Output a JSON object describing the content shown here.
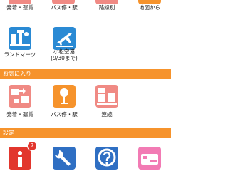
{
  "search": {
    "items": [
      {
        "label": "発着・運賃"
      },
      {
        "label": "バス停・駅"
      },
      {
        "label": "路線別"
      },
      {
        "label": "地図から"
      },
      {
        "label": "ランドマーク"
      },
      {
        "label": "小松空港",
        "sublabel": "(9/30まで)"
      }
    ]
  },
  "favorites": {
    "title": "お気に入り",
    "items": [
      {
        "label": "発着・運賃"
      },
      {
        "label": "バス停・駅"
      },
      {
        "label": "連続"
      }
    ]
  },
  "settings": {
    "title": "設定",
    "badge_count": "7"
  },
  "colors": {
    "accent": "#f6932c",
    "sky": "#2a8ad4",
    "salmon": "#f08a84",
    "red": "#e2362d",
    "blue": "#2f6fc3",
    "pink": "#f27bb4"
  }
}
